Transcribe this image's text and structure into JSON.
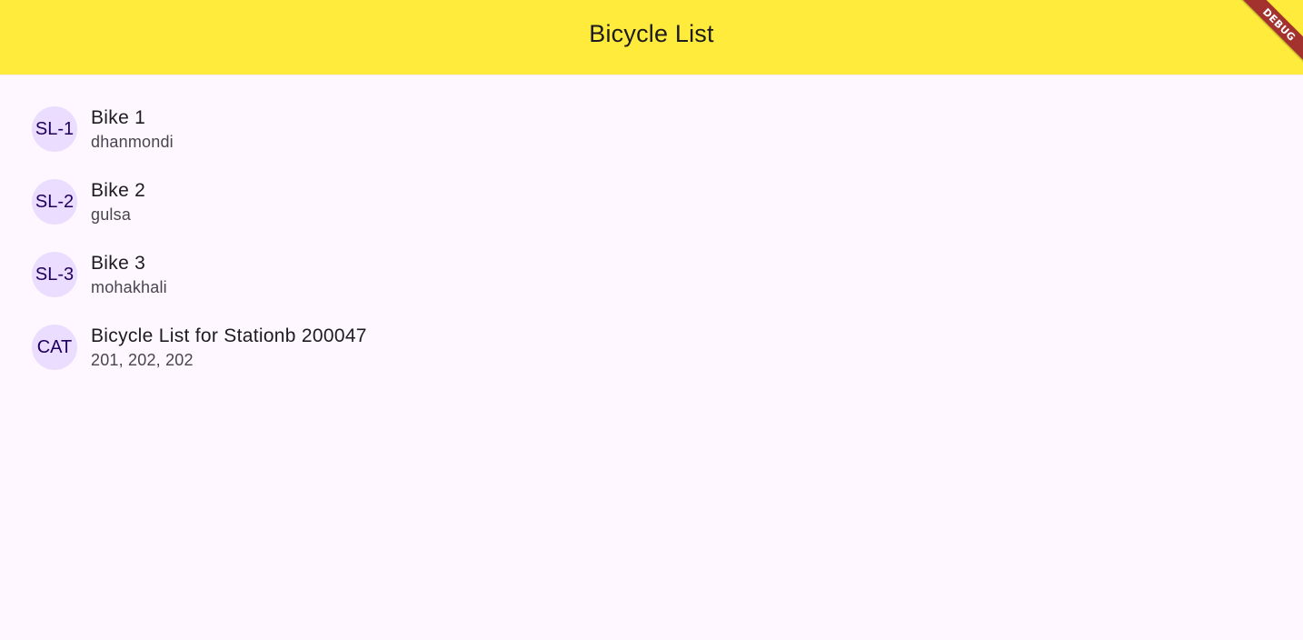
{
  "app_bar": {
    "title": "Bicycle List",
    "background_color": "#ffeb3b"
  },
  "debug_banner": {
    "label": "DEBUG",
    "color": "#a3312e"
  },
  "list": {
    "items": [
      {
        "avatar": "SL-1",
        "title": "Bike 1",
        "subtitle": "dhanmondi"
      },
      {
        "avatar": "SL-2",
        "title": "Bike 2",
        "subtitle": "gulsa"
      },
      {
        "avatar": "SL-3",
        "title": "Bike 3",
        "subtitle": "mohakhali"
      },
      {
        "avatar": "CAT",
        "title": "Bicycle List for Stationb 200047",
        "subtitle": "201, 202, 202"
      }
    ]
  },
  "colors": {
    "background": "#fef7ff",
    "avatar_background": "#eaddff",
    "avatar_text": "#21005d",
    "title_text": "#1d1b20",
    "subtitle_text": "#49454f"
  }
}
